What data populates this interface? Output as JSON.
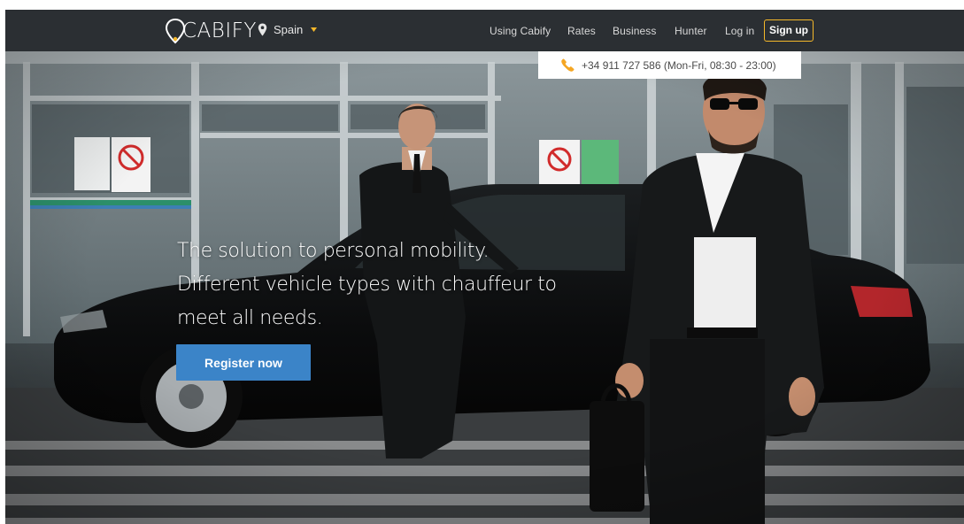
{
  "header": {
    "brand": "CABIFY",
    "city": "Spain",
    "nav": [
      "Using Cabify",
      "Rates",
      "Business",
      "Hunter",
      "Log in"
    ],
    "signup_label": "Sign up",
    "accent_color": "#f5b82a",
    "bar_color": "#2b2f33"
  },
  "contact": {
    "phone_text": "+34 911 727 586 (Mon-Fri, 08:30 - 23:00)"
  },
  "hero": {
    "tagline_lines": [
      "The solution to personal mobility.",
      "Different vehicle types with chauffeur to",
      "meet all needs."
    ],
    "cta_label": "Register now",
    "cta_color": "#3b84c8"
  },
  "icons": {
    "logo": "map-pin-logo",
    "city": "location-pin-icon",
    "city_dropdown": "caret-down-icon",
    "phone": "phone-icon"
  }
}
